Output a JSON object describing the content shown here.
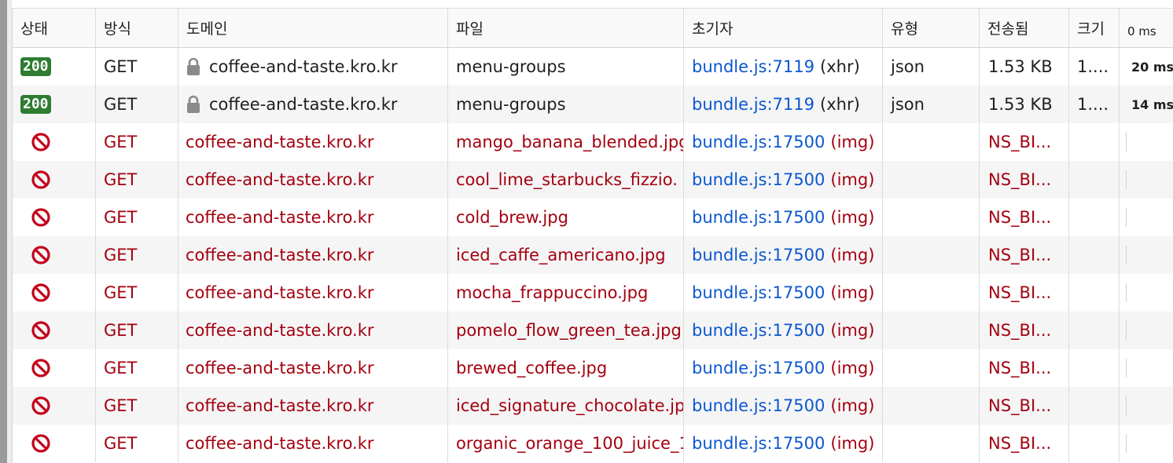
{
  "columns": {
    "status": "상태",
    "method": "방식",
    "domain": "도메인",
    "file": "파일",
    "initiator": "초기자",
    "type": "유형",
    "transferred": "전송됨",
    "size": "크기",
    "timeline": "0 ms"
  },
  "rows": [
    {
      "status": "200",
      "blocked": false,
      "method": "GET",
      "domain": "coffee-and-taste.kro.kr",
      "file": "menu-groups",
      "initiator_link": "bundle.js:7119",
      "initiator_kind": "(xhr)",
      "type": "json",
      "transferred": "1.53 KB",
      "size": "1....",
      "timing": "20 ms"
    },
    {
      "status": "200",
      "blocked": false,
      "method": "GET",
      "domain": "coffee-and-taste.kro.kr",
      "file": "menu-groups",
      "initiator_link": "bundle.js:7119",
      "initiator_kind": "(xhr)",
      "type": "json",
      "transferred": "1.53 KB",
      "size": "1....",
      "timing": "14 ms"
    },
    {
      "status": "",
      "blocked": true,
      "method": "GET",
      "domain": "coffee-and-taste.kro.kr",
      "file": "mango_banana_blended.jpg",
      "initiator_link": "bundle.js:17500",
      "initiator_kind": "(img)",
      "type": "",
      "transferred": "NS_BI...",
      "size": "",
      "timing": ""
    },
    {
      "status": "",
      "blocked": true,
      "method": "GET",
      "domain": "coffee-and-taste.kro.kr",
      "file": "cool_lime_starbucks_fizzio.",
      "initiator_link": "bundle.js:17500",
      "initiator_kind": "(img)",
      "type": "",
      "transferred": "NS_BI...",
      "size": "",
      "timing": ""
    },
    {
      "status": "",
      "blocked": true,
      "method": "GET",
      "domain": "coffee-and-taste.kro.kr",
      "file": "cold_brew.jpg",
      "initiator_link": "bundle.js:17500",
      "initiator_kind": "(img)",
      "type": "",
      "transferred": "NS_BI...",
      "size": "",
      "timing": ""
    },
    {
      "status": "",
      "blocked": true,
      "method": "GET",
      "domain": "coffee-and-taste.kro.kr",
      "file": "iced_caffe_americano.jpg",
      "initiator_link": "bundle.js:17500",
      "initiator_kind": "(img)",
      "type": "",
      "transferred": "NS_BI...",
      "size": "",
      "timing": ""
    },
    {
      "status": "",
      "blocked": true,
      "method": "GET",
      "domain": "coffee-and-taste.kro.kr",
      "file": "mocha_frappuccino.jpg",
      "initiator_link": "bundle.js:17500",
      "initiator_kind": "(img)",
      "type": "",
      "transferred": "NS_BI...",
      "size": "",
      "timing": ""
    },
    {
      "status": "",
      "blocked": true,
      "method": "GET",
      "domain": "coffee-and-taste.kro.kr",
      "file": "pomelo_flow_green_tea.jpg",
      "initiator_link": "bundle.js:17500",
      "initiator_kind": "(img)",
      "type": "",
      "transferred": "NS_BI...",
      "size": "",
      "timing": ""
    },
    {
      "status": "",
      "blocked": true,
      "method": "GET",
      "domain": "coffee-and-taste.kro.kr",
      "file": "brewed_coffee.jpg",
      "initiator_link": "bundle.js:17500",
      "initiator_kind": "(img)",
      "type": "",
      "transferred": "NS_BI...",
      "size": "",
      "timing": ""
    },
    {
      "status": "",
      "blocked": true,
      "method": "GET",
      "domain": "coffee-and-taste.kro.kr",
      "file": "iced_signature_chocolate.jp",
      "initiator_link": "bundle.js:17500",
      "initiator_kind": "(img)",
      "type": "",
      "transferred": "NS_BI...",
      "size": "",
      "timing": ""
    },
    {
      "status": "",
      "blocked": true,
      "method": "GET",
      "domain": "coffee-and-taste.kro.kr",
      "file": "organic_orange_100_juice_1",
      "initiator_link": "bundle.js:17500",
      "initiator_kind": "(img)",
      "type": "",
      "transferred": "NS_BI...",
      "size": "",
      "timing": ""
    }
  ],
  "colors": {
    "ok_badge": "#2e7d32",
    "blocked_text": "#a4000f",
    "initiator_link": "#0b57d0",
    "timing_bar": "#5b8fd6"
  },
  "icons": {
    "blocked": "blocked-icon",
    "lock": "lock-icon"
  }
}
